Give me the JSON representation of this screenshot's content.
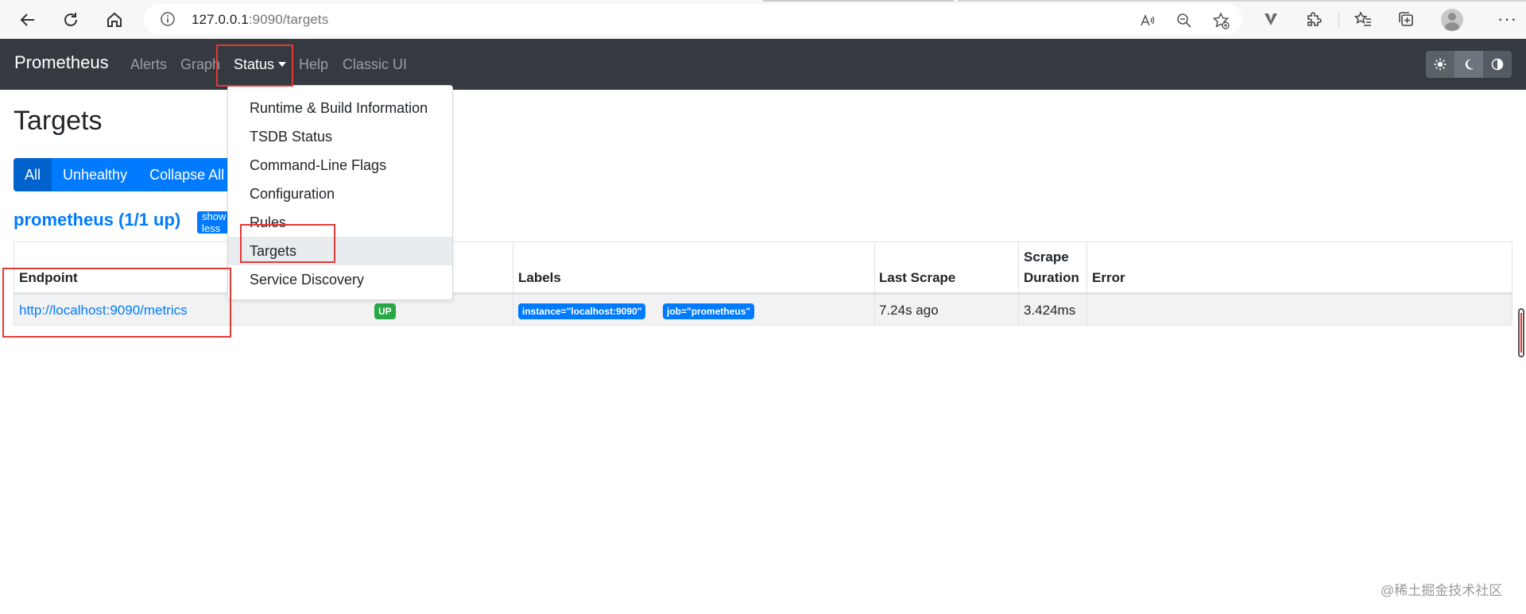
{
  "browser": {
    "url_host": "127.0.0.1",
    "url_rest": ":9090/targets"
  },
  "navbar": {
    "brand": "Prometheus",
    "links": {
      "alerts": "Alerts",
      "graph": "Graph",
      "status": "Status",
      "help": "Help",
      "classic": "Classic UI"
    }
  },
  "dropdown": {
    "items": [
      "Runtime & Build Information",
      "TSDB Status",
      "Command-Line Flags",
      "Configuration",
      "Rules",
      "Targets",
      "Service Discovery"
    ]
  },
  "page": {
    "title": "Targets",
    "filters": [
      "All",
      "Unhealthy",
      "Collapse All"
    ],
    "pool_title": "prometheus (1/1 up)",
    "show_less": "show less"
  },
  "table": {
    "headers": {
      "endpoint": "Endpoint",
      "labels": "Labels",
      "last_scrape": "Last Scrape",
      "scrape_duration_1": "Scrape",
      "scrape_duration_2": "Duration",
      "error": "Error"
    },
    "row": {
      "endpoint": "http://localhost:9090/metrics",
      "state": "UP",
      "labels": [
        "instance=\"localhost:9090\"",
        "job=\"prometheus\""
      ],
      "last_scrape": "7.24s ago",
      "scrape_duration": "3.424ms",
      "error": ""
    }
  },
  "watermark": "@稀土掘金技术社区",
  "colors": {
    "navbar_bg": "#343a40",
    "primary": "#007bff",
    "success": "#28a745",
    "annotation": "#e53935"
  }
}
